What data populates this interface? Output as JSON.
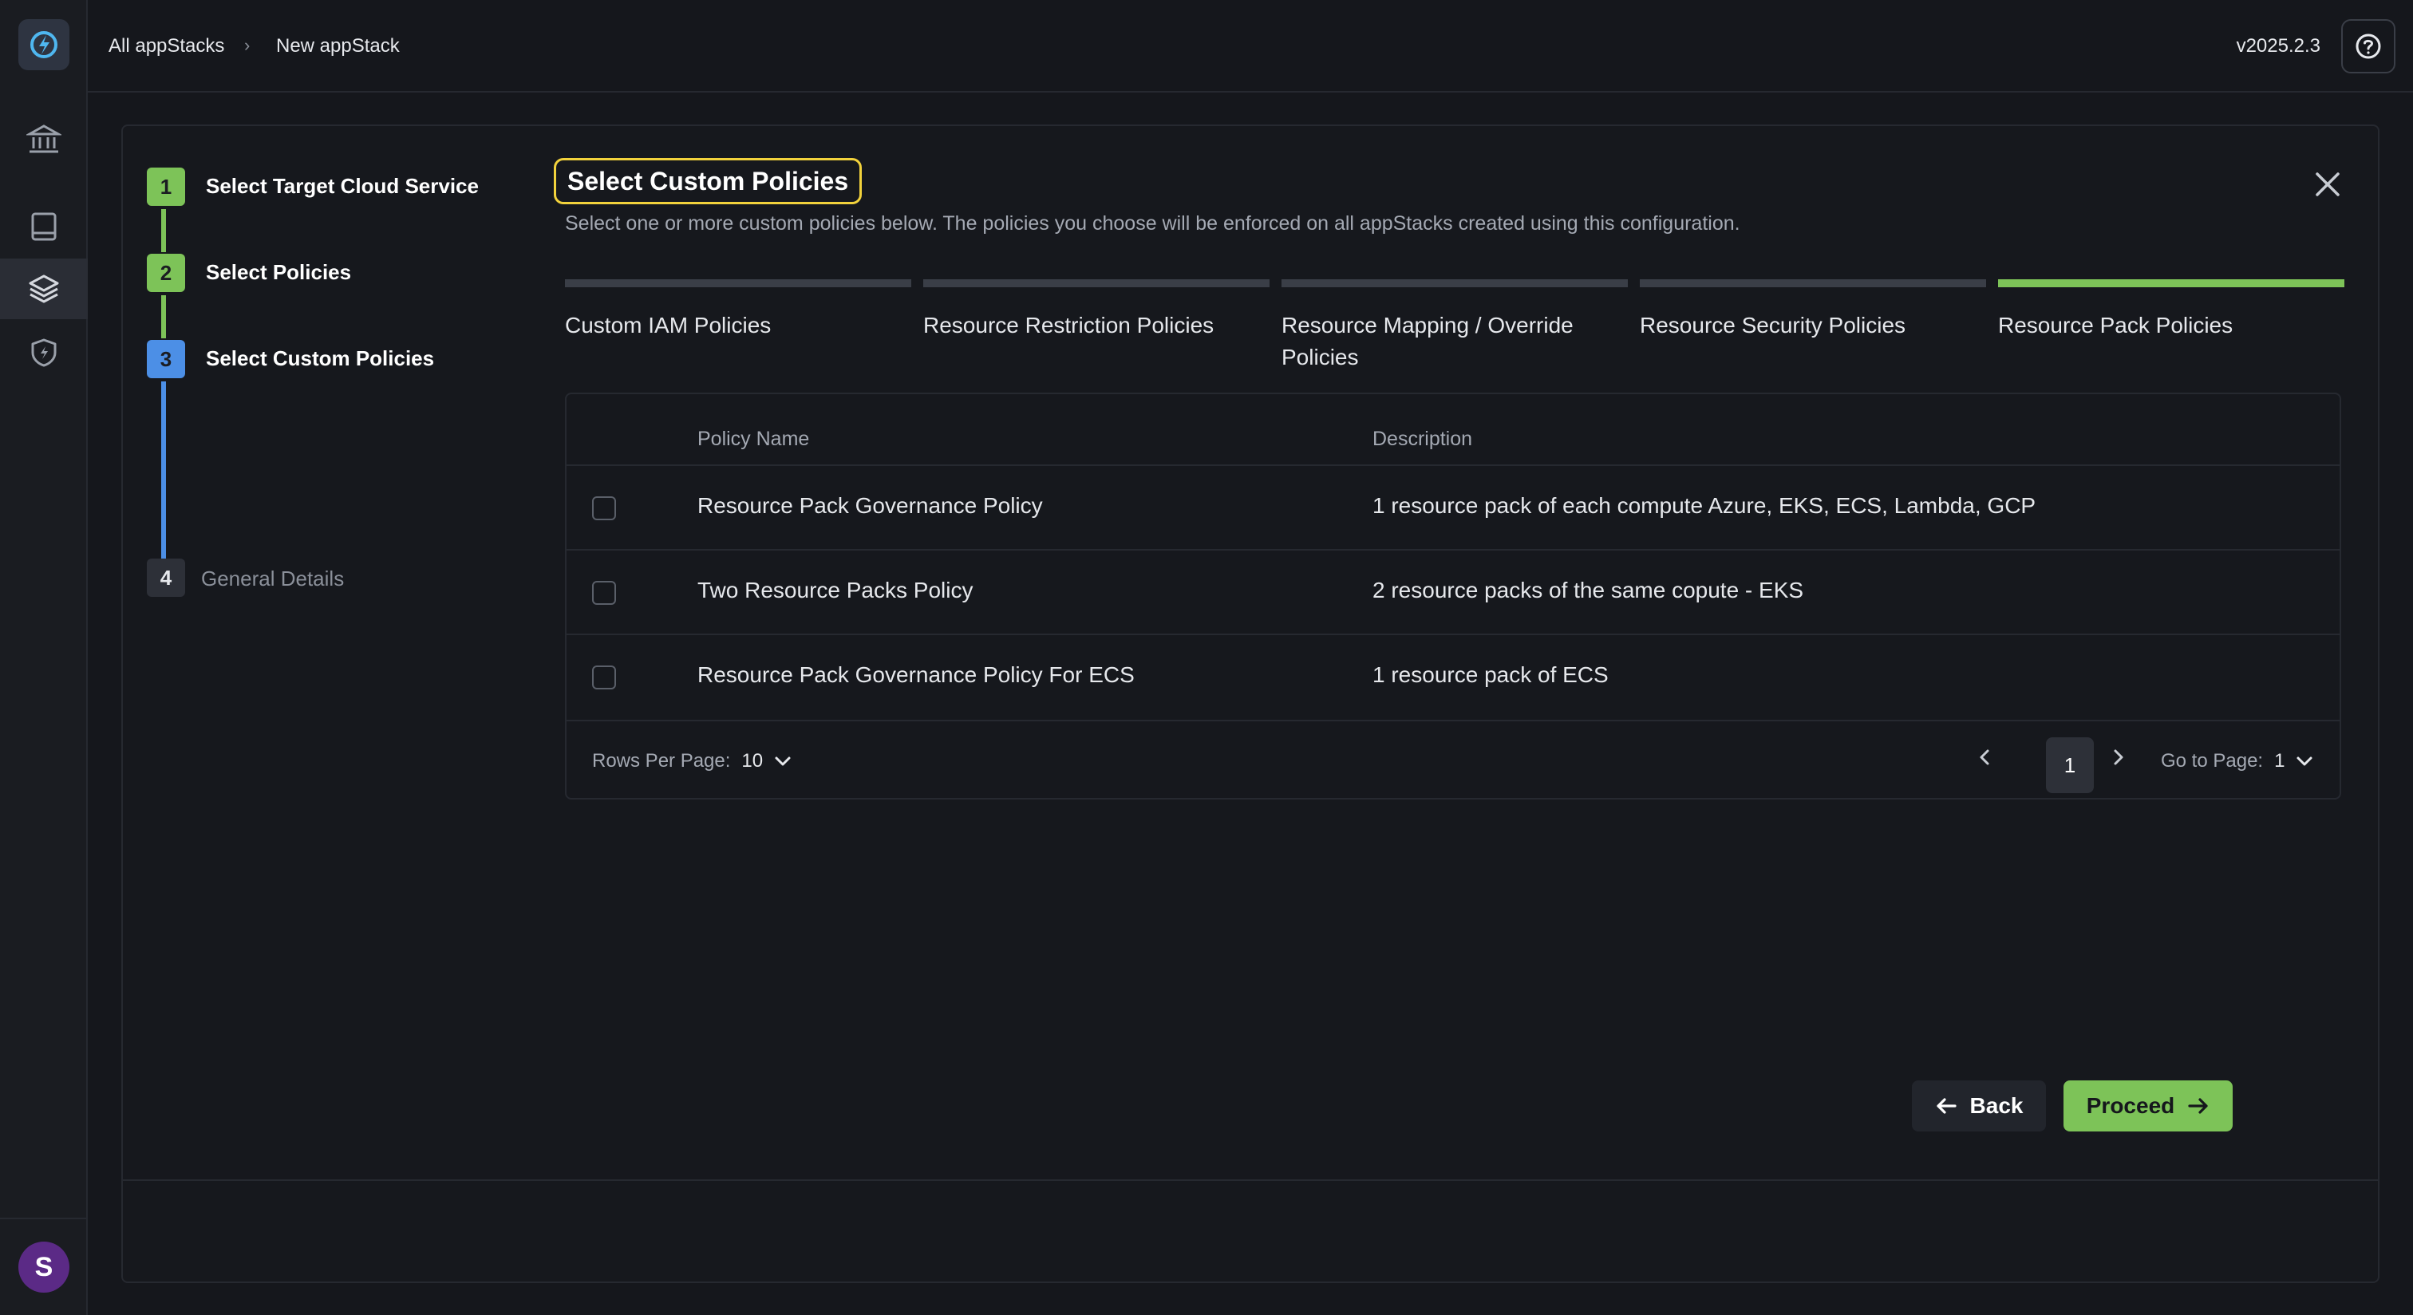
{
  "app": {
    "version": "v2025.2.3",
    "user_initial": "S"
  },
  "breadcrumb": {
    "root": "All appStacks",
    "current": "New appStack"
  },
  "stepper": {
    "steps": [
      {
        "number": "1",
        "label": "Select Target Cloud Service",
        "state": "done"
      },
      {
        "number": "2",
        "label": "Select Policies",
        "state": "done"
      },
      {
        "number": "3",
        "label": "Select Custom Policies",
        "state": "active"
      },
      {
        "number": "4",
        "label": "General Details",
        "state": "pending"
      }
    ]
  },
  "header": {
    "title": "Select Custom Policies",
    "subtitle": "Select one or more custom policies below. The policies you choose will be enforced on all appStacks created using this configuration."
  },
  "tabs": [
    {
      "label": "Custom IAM Policies",
      "active": false
    },
    {
      "label": "Resource Restriction Policies",
      "active": false
    },
    {
      "label": "Resource Mapping / Override Policies",
      "active": false
    },
    {
      "label": "Resource Security Policies",
      "active": false
    },
    {
      "label": "Resource Pack Policies",
      "active": true
    }
  ],
  "table": {
    "columns": {
      "name": "Policy Name",
      "description": "Description"
    },
    "rows": [
      {
        "name": "Resource Pack Governance Policy",
        "description": "1 resource pack of each compute Azure, EKS, ECS, Lambda, GCP",
        "checked": false
      },
      {
        "name": "Two Resource Packs Policy",
        "description": "2 resource packs of the same copute - EKS",
        "checked": false
      },
      {
        "name": "Resource Pack Governance Policy For ECS",
        "description": "1 resource pack of ECS",
        "checked": false
      }
    ],
    "footer": {
      "rows_per_page_label": "Rows Per Page:",
      "rows_per_page_value": "10",
      "current_page": "1",
      "goto_label": "Go to Page:",
      "goto_value": "1"
    }
  },
  "actions": {
    "back": "Back",
    "proceed": "Proceed"
  },
  "colors": {
    "accent_green": "#7dc358",
    "accent_blue": "#4c8fe6",
    "focus_yellow": "#f2d23c",
    "avatar_purple": "#5b2a86"
  }
}
